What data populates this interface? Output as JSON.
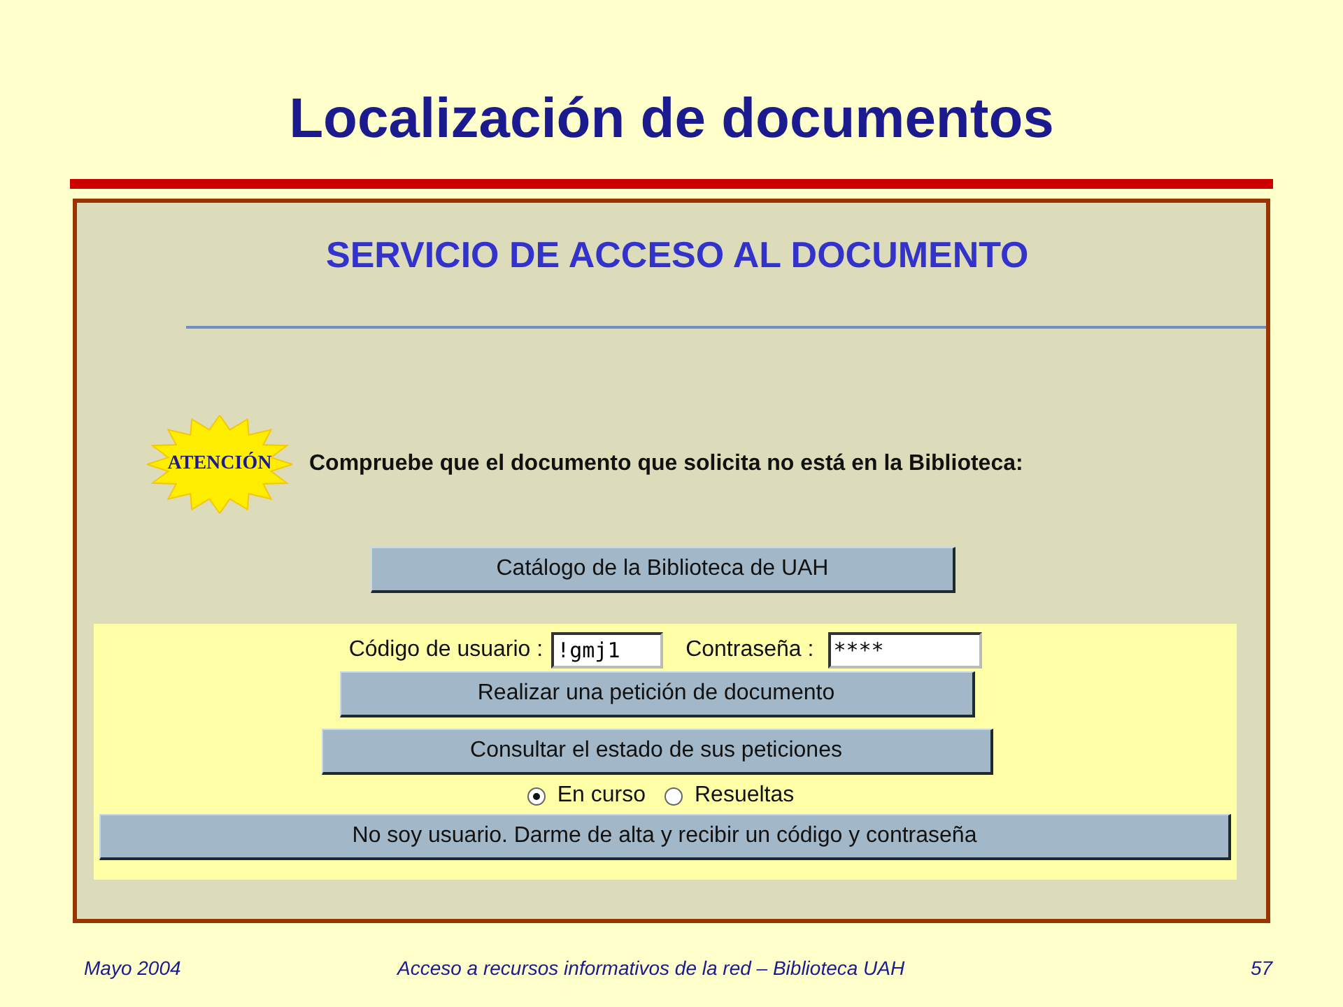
{
  "slide": {
    "title": "Localización de documentos",
    "footer": {
      "date": "Mayo 2004",
      "caption": "Acceso a recursos informativos de la red – Biblioteca UAH",
      "page": "57"
    }
  },
  "page": {
    "heading": "SERVICIO DE ACCESO AL DOCUMENTO",
    "notice": {
      "badge": "ATENCIÓN",
      "text": "Compruebe que el documento que solicita no está en la Biblioteca:"
    },
    "catalog_button": "Catálogo de la Biblioteca de UAH",
    "login": {
      "user_label": "Código de usuario :",
      "user_value": "!gmj1",
      "password_label": "Contraseña :",
      "password_value": "****"
    },
    "buttons": [
      "Realizar una petición de documento",
      "Consultar el estado de sus peticiones"
    ],
    "radios": [
      {
        "label": "En curso",
        "selected": true
      },
      {
        "label": "Resueltas",
        "selected": false
      }
    ],
    "signup_button": "No soy usuario. Darme de alta y recibir un código y contraseña"
  }
}
